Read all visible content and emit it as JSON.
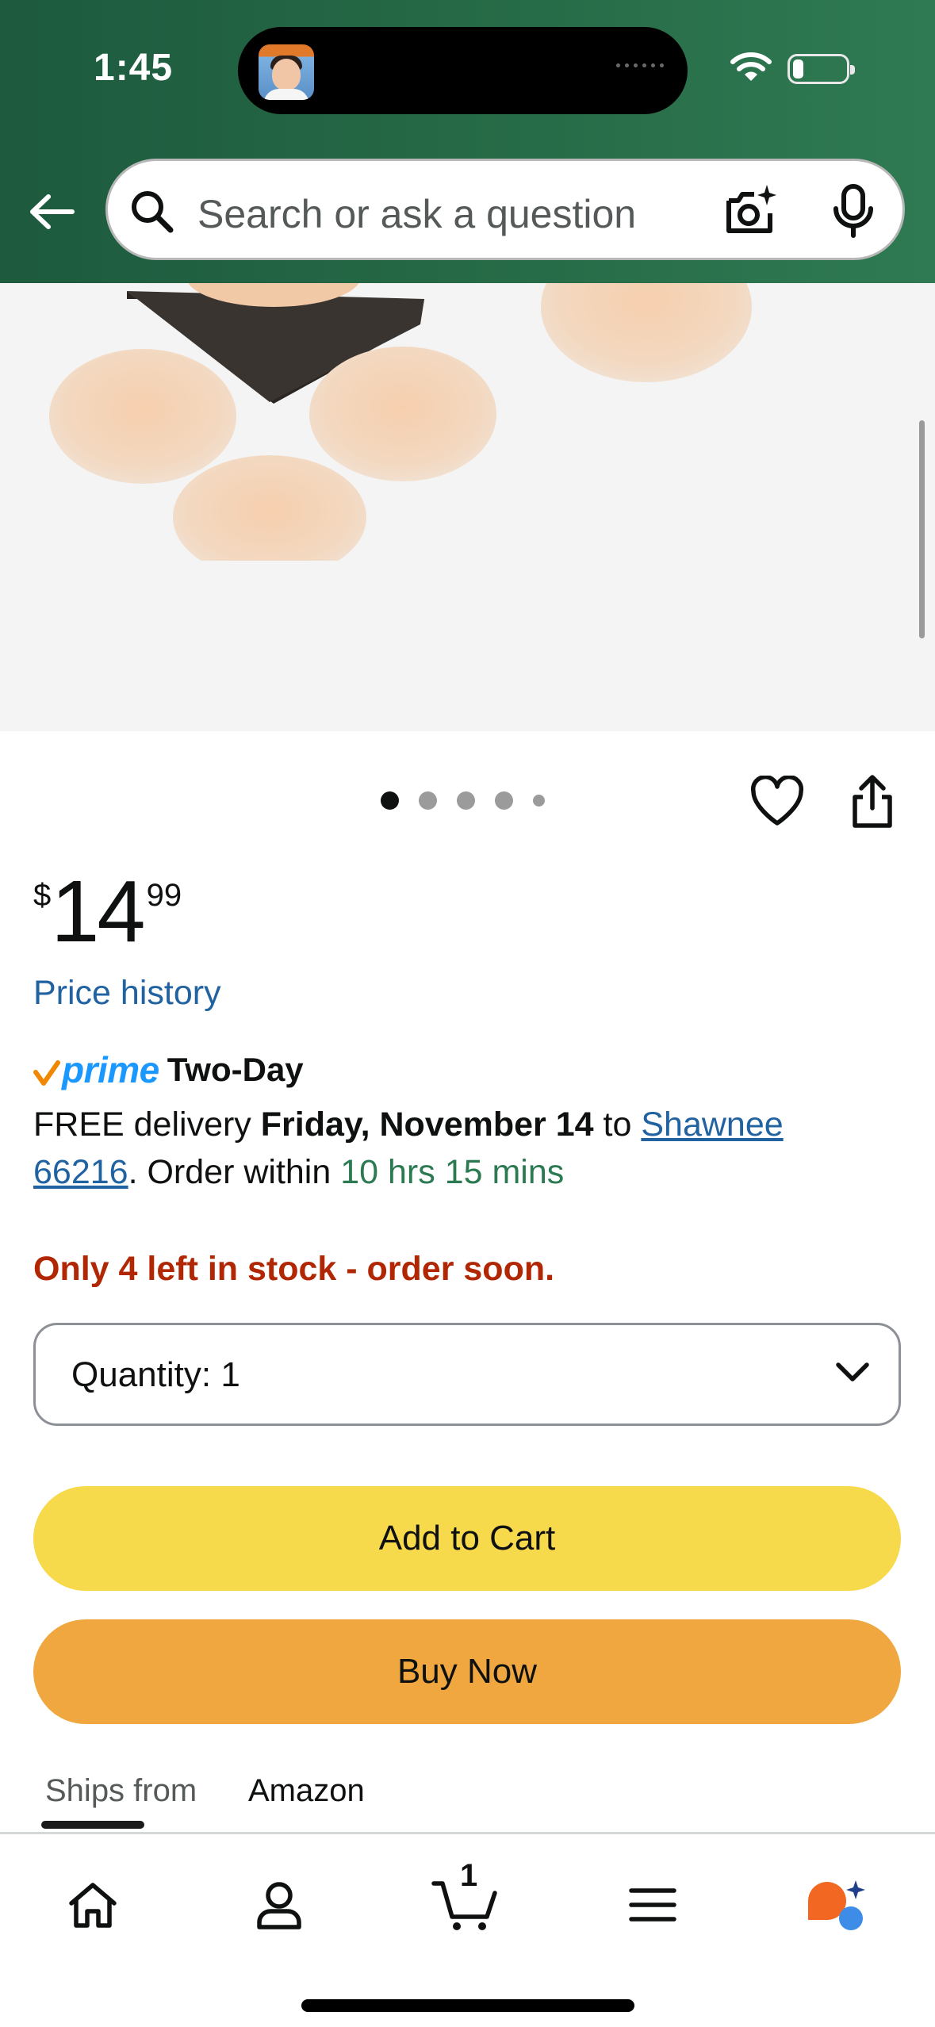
{
  "status_bar": {
    "time": "1:45"
  },
  "search": {
    "placeholder": "Search or ask a question"
  },
  "carousel": {
    "total_images": 5,
    "active_index": 0
  },
  "price": {
    "symbol": "$",
    "whole": "14",
    "fraction": "99"
  },
  "price_history_link": "Price history",
  "delivery": {
    "prime_label": "prime",
    "speed": "Two-Day",
    "free_delivery": "FREE delivery",
    "date": "Friday, November 14",
    "to": "to",
    "location_line1": "Shawnee",
    "location_line2": "66216",
    "order_within_prefix": ". Order within",
    "time_remaining": "10 hrs 15 mins"
  },
  "stock_message": "Only 4 left in stock - order soon.",
  "quantity": {
    "label": "Quantity:",
    "value": "1"
  },
  "buttons": {
    "add_to_cart": "Add to Cart",
    "buy_now": "Buy Now"
  },
  "shipping_info": {
    "ships_from_label": "Ships from",
    "ships_from_value": "Amazon"
  },
  "tabbar": {
    "items": [
      "home-icon",
      "account-icon",
      "cart-icon",
      "menu-icon",
      "rufus-ai-icon"
    ],
    "cart_count": "1"
  },
  "colors": {
    "header_green": "#266b47",
    "add_to_cart": "#f7d94c",
    "buy_now": "#f0a73f",
    "link_blue": "#2162a1",
    "stock_red": "#b12704",
    "countdown_green": "#2b7a52",
    "prime_blue": "#1a98ff"
  }
}
